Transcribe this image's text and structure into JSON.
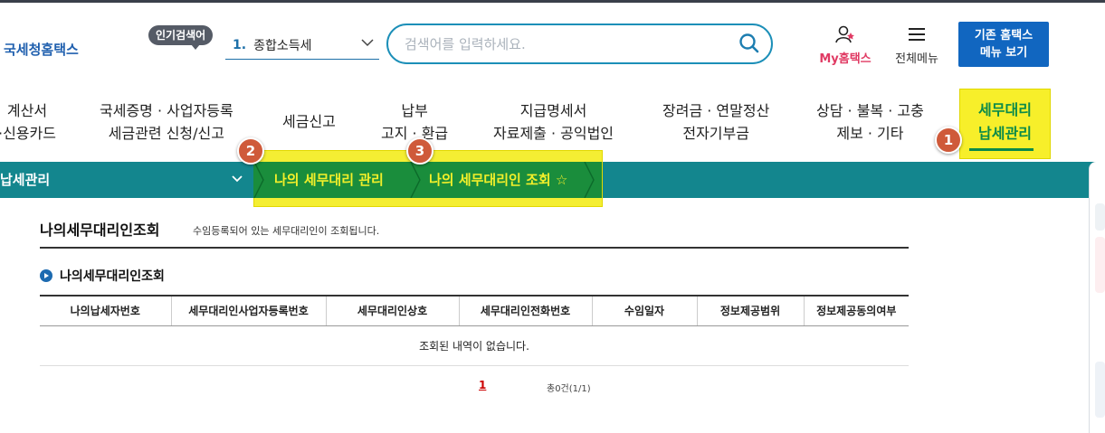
{
  "header": {
    "logo": "국세청홈택스",
    "popular_badge": "인기검색어",
    "popular_rank": "1.",
    "popular_term": "종합소득세",
    "search_placeholder": "검색어를 입력하세요.",
    "my_label": "My홈택스",
    "allmenu_label": "전체메뉴",
    "old_menu_line1": "기존 홈택스",
    "old_menu_line2": "메뉴 보기"
  },
  "gnb": {
    "items": [
      {
        "line1": "계산서",
        "line2": "·신용카드"
      },
      {
        "line1": "국세증명 · 사업자등록",
        "line2": "세금관련 신청/신고"
      },
      {
        "line1": "세금신고",
        "line2": ""
      },
      {
        "line1": "납부",
        "line2": "고지 · 환급"
      },
      {
        "line1": "지급명세서",
        "line2": "자료제출 · 공익법인"
      },
      {
        "line1": "장려금 · 연말정산",
        "line2": "전자기부금"
      },
      {
        "line1": "상담 · 불복 · 고충",
        "line2": "제보 · 기타"
      }
    ],
    "active": {
      "line1": "세무대리",
      "line2": "납세관리"
    }
  },
  "markers": [
    "1",
    "2",
    "3"
  ],
  "breadcrumb": {
    "first": "납세관리",
    "second": "나의 세무대리 관리",
    "third": "나의 세무대리인 조회",
    "star": "☆"
  },
  "content": {
    "title": "나의세무대리인조회",
    "description": "수임등록되어 있는 세무대리인이 조회됩니다.",
    "section_title": "나의세무대리인조회",
    "table_headers": [
      "나의납세자번호",
      "세무대리인사업자등록번호",
      "세무대리인상호",
      "세무대리인전화번호",
      "수임일자",
      "정보제공범위",
      "정보제공동의여부"
    ],
    "empty_message": "조회된 내역이 없습니다.",
    "page_number": "1",
    "total_text": "총0건(1/1)"
  },
  "colors": {
    "teal_bar": "#13868e",
    "highlight_yellow": "#f4ee33",
    "active_green": "#0a8a4a",
    "marker": "#cf5a3a",
    "button_blue": "#1166c0"
  }
}
